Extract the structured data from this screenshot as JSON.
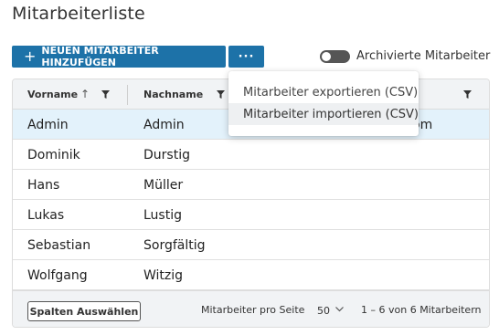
{
  "page": {
    "title": "Mitarbeiterliste"
  },
  "toolbar": {
    "add_label": "NEUEN MITARBEITER HINZUFÜGEN",
    "more_label": "···",
    "archive_toggle_label": "Archivierte Mitarbeiter",
    "archive_toggle_on": false
  },
  "menu": {
    "items": [
      {
        "label": "Mitarbeiter exportieren (CSV)"
      },
      {
        "label": "Mitarbeiter importieren (CSV)"
      }
    ]
  },
  "table": {
    "columns": [
      {
        "label": "Vorname",
        "sort": "ascending"
      },
      {
        "label": "Nachname"
      },
      {
        "label": ""
      }
    ],
    "rows": [
      {
        "vorname": "Admin",
        "nachname": "Admin",
        "email_fragment": "4.com",
        "selected": true
      },
      {
        "vorname": "Dominik",
        "nachname": "Durstig"
      },
      {
        "vorname": "Hans",
        "nachname": "Müller"
      },
      {
        "vorname": "Lukas",
        "nachname": "Lustig"
      },
      {
        "vorname": "Sebastian",
        "nachname": "Sorgfältig"
      },
      {
        "vorname": "Wolfgang",
        "nachname": "Witzig"
      }
    ]
  },
  "footer": {
    "columns_button": "Spalten Auswählen",
    "per_page_label": "Mitarbeiter pro Seite",
    "per_page_value": "50",
    "range_label": "1 – 6 von 6 Mitarbeitern"
  },
  "icons": {
    "add": "plus-icon",
    "sort": "arrow-up-icon",
    "filter": "filter-icon",
    "select": "chevron-down-icon"
  },
  "colors": {
    "primary": "#1d72a8",
    "selected_row": "#e3f2fb",
    "header_bg": "#f1f3f5"
  }
}
